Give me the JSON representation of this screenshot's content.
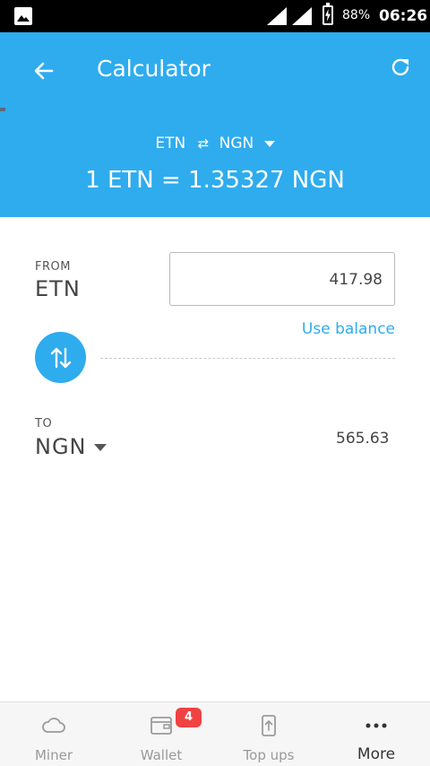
{
  "status_bar": {
    "battery": "88%",
    "time": "06:26"
  },
  "header": {
    "title": "Calculator",
    "pair_from": "ETN",
    "pair_to": "NGN",
    "rate": "1 ETN = 1.35327 NGN",
    "color": "#2eacee"
  },
  "from": {
    "label": "FROM",
    "currency": "ETN",
    "amount": "417.98",
    "use_balance": "Use balance"
  },
  "to": {
    "label": "TO",
    "currency": "NGN",
    "result": "565.63"
  },
  "nav": {
    "items": [
      {
        "label": "Miner",
        "icon": "cloud-icon"
      },
      {
        "label": "Wallet",
        "icon": "wallet-icon",
        "badge": "4"
      },
      {
        "label": "Top ups",
        "icon": "topup-icon"
      },
      {
        "label": "More",
        "icon": "more-icon"
      }
    ],
    "active": "More"
  }
}
